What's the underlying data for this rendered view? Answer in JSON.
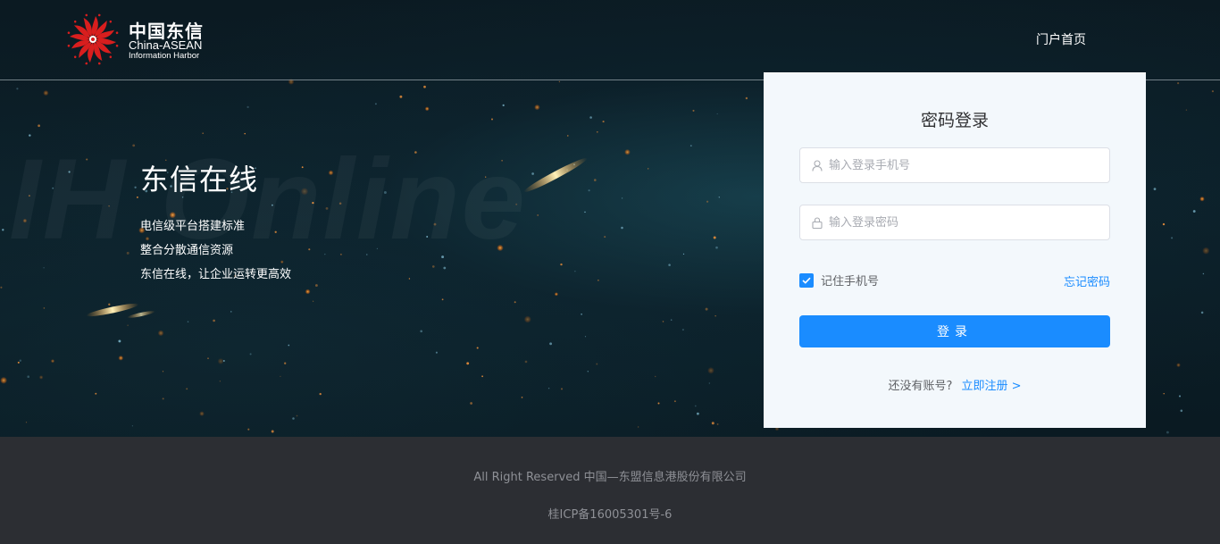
{
  "header": {
    "logo": {
      "cn": "中国东信",
      "en_line1": "China-ASEAN",
      "en_line2": "Information Harbor"
    },
    "nav_home": "门户首页"
  },
  "hero": {
    "watermark": "IH Online",
    "title": "东信在线",
    "lines": [
      "电信级平台搭建标准",
      "整合分散通信资源",
      "东信在线，让企业运转更高效"
    ]
  },
  "login": {
    "title": "密码登录",
    "phone_placeholder": "输入登录手机号",
    "password_placeholder": "输入登录密码",
    "remember_label": "记住手机号",
    "remember_checked": true,
    "forgot_label": "忘记密码",
    "submit_label": "登录",
    "register_prompt": "还没有账号?",
    "register_link": "立即注册 >"
  },
  "footer": {
    "copyright": "All Right Reserved 中国—东盟信息港股份有限公司",
    "icp": "桂ICP备16005301号-6"
  },
  "colors": {
    "primary": "#1a8cff",
    "logo_red": "#d81e1e",
    "footer_bg": "#2c2e33"
  },
  "icons": {
    "user": "user-icon",
    "lock": "lock-icon",
    "check": "check-icon"
  }
}
